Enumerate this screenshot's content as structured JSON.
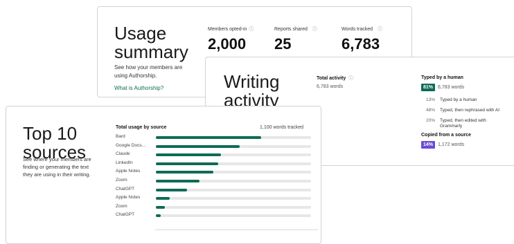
{
  "colors": {
    "accent": "#0f6b56",
    "human": "#0f6b56",
    "copied": "#6c4cd0",
    "track": "#e7e7e7"
  },
  "usage": {
    "title": "Usage summary",
    "description": "See how your members are using Authorship.",
    "link": "What is Authorship?",
    "stats": [
      {
        "label": "Members opted-in",
        "value": "2,000",
        "icon": "info-icon"
      },
      {
        "label": "Reports shared",
        "value": "25",
        "icon": "info-icon"
      },
      {
        "label": "Words tracked",
        "value": "6,783",
        "icon": "info-icon"
      }
    ]
  },
  "writing": {
    "title": "Writing activity",
    "total_label": "Total activity",
    "total_value": "6,783 words",
    "human": {
      "title": "Typed by a human",
      "pct": "81%",
      "words": "6,783 words",
      "breakdown": [
        {
          "pct": "13%",
          "label": "Typed by a human"
        },
        {
          "pct": "48%",
          "label": "Typed, then rephrased with AI"
        },
        {
          "pct": "20%",
          "label": "Typed, then edited with Grammarly"
        }
      ]
    },
    "copied": {
      "title": "Copied from a source",
      "pct": "14%",
      "words": "1,172 words"
    }
  },
  "top10": {
    "title": "Top 10 sources",
    "description": "See where your members are finding or generating the text they are using in their writing.",
    "header": "Total usage by source",
    "header_right": "1,100 words tracked",
    "sources": [
      {
        "name": "Bard",
        "fraction": 0.68
      },
      {
        "name": "Google Docs...",
        "fraction": 0.54
      },
      {
        "name": "Claude",
        "fraction": 0.42
      },
      {
        "name": "LinkedIn",
        "fraction": 0.4
      },
      {
        "name": "Apple Notes",
        "fraction": 0.37
      },
      {
        "name": "Zoom",
        "fraction": 0.28
      },
      {
        "name": "ChatGPT",
        "fraction": 0.2
      },
      {
        "name": "Apple Notes",
        "fraction": 0.09
      },
      {
        "name": "Zoom",
        "fraction": 0.06
      },
      {
        "name": "ChatGPT",
        "fraction": 0.03
      }
    ]
  }
}
